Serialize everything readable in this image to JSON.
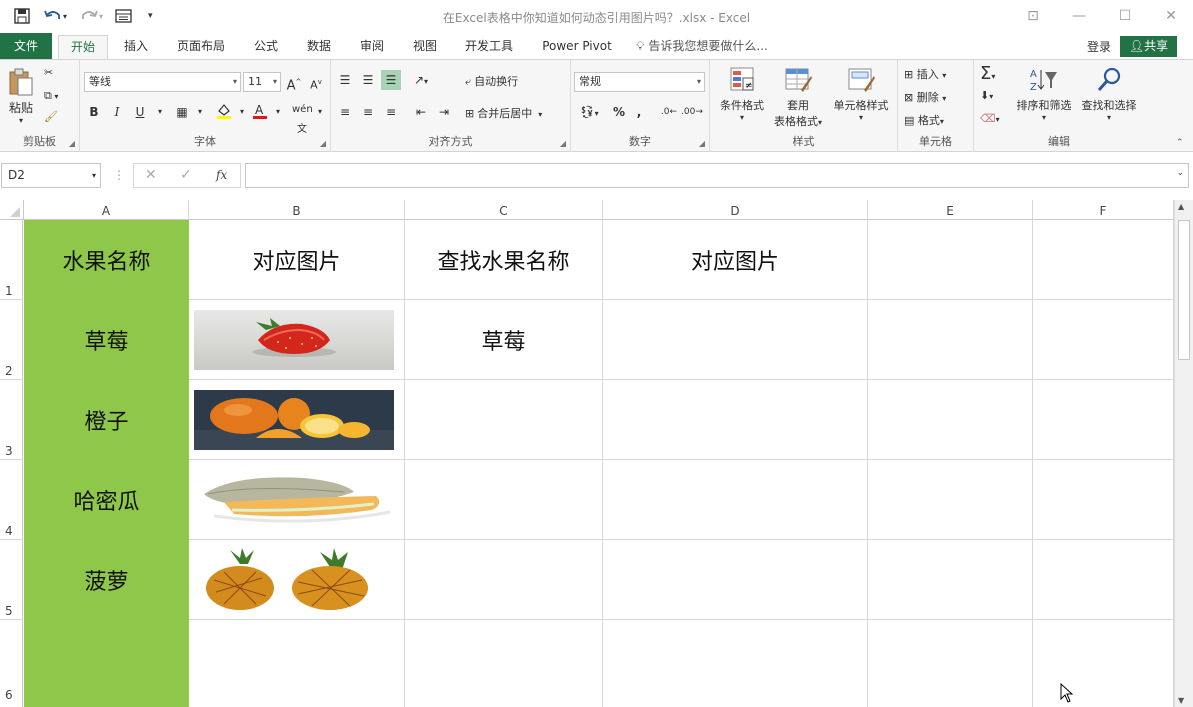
{
  "window": {
    "title": "在Excel表格中你知道如何动态引用图片吗？.xlsx - Excel"
  },
  "ribbon_tabs": [
    "文件",
    "开始",
    "插入",
    "页面布局",
    "公式",
    "数据",
    "审阅",
    "视图",
    "开发工具",
    "Power Pivot"
  ],
  "tell_me": "告诉我您想要做什么...",
  "account": {
    "login": "登录",
    "share": "共享"
  },
  "clipboard": {
    "paste": "粘贴",
    "label": "剪贴板"
  },
  "font": {
    "name": "等线",
    "size": "11",
    "label": "字体",
    "bold": "B",
    "italic": "I",
    "underline": "U"
  },
  "alignment": {
    "wrap": "自动换行",
    "merge": "合并后居中",
    "label": "对齐方式"
  },
  "number": {
    "format": "常规",
    "label": "数字",
    "percent": "%",
    "comma": ","
  },
  "styles": {
    "conditional": "条件格式",
    "table_1": "套用",
    "table_2": "表格格式",
    "cell_styles": "单元格样式",
    "label": "样式"
  },
  "cells": {
    "insert": "插入",
    "delete": "删除",
    "format": "格式",
    "label": "单元格"
  },
  "editing": {
    "sort": "排序和筛选",
    "find": "查找和选择",
    "label": "编辑"
  },
  "formula_bar": {
    "name_box": "D2",
    "fx": "fx",
    "value": ""
  },
  "columns": [
    "A",
    "B",
    "C",
    "D",
    "E",
    "F"
  ],
  "rows": [
    "1",
    "2",
    "3",
    "4",
    "5",
    "6"
  ],
  "sheet": {
    "A1": "水果名称",
    "B1": "对应图片",
    "C1": "查找水果名称",
    "D1": "对应图片",
    "A2": "草莓",
    "A3": "橙子",
    "A4": "哈密瓜",
    "A5": "菠萝",
    "C2": "草莓"
  },
  "colors": {
    "excel_green": "#217346",
    "fruit_column": "#8ec74a"
  }
}
